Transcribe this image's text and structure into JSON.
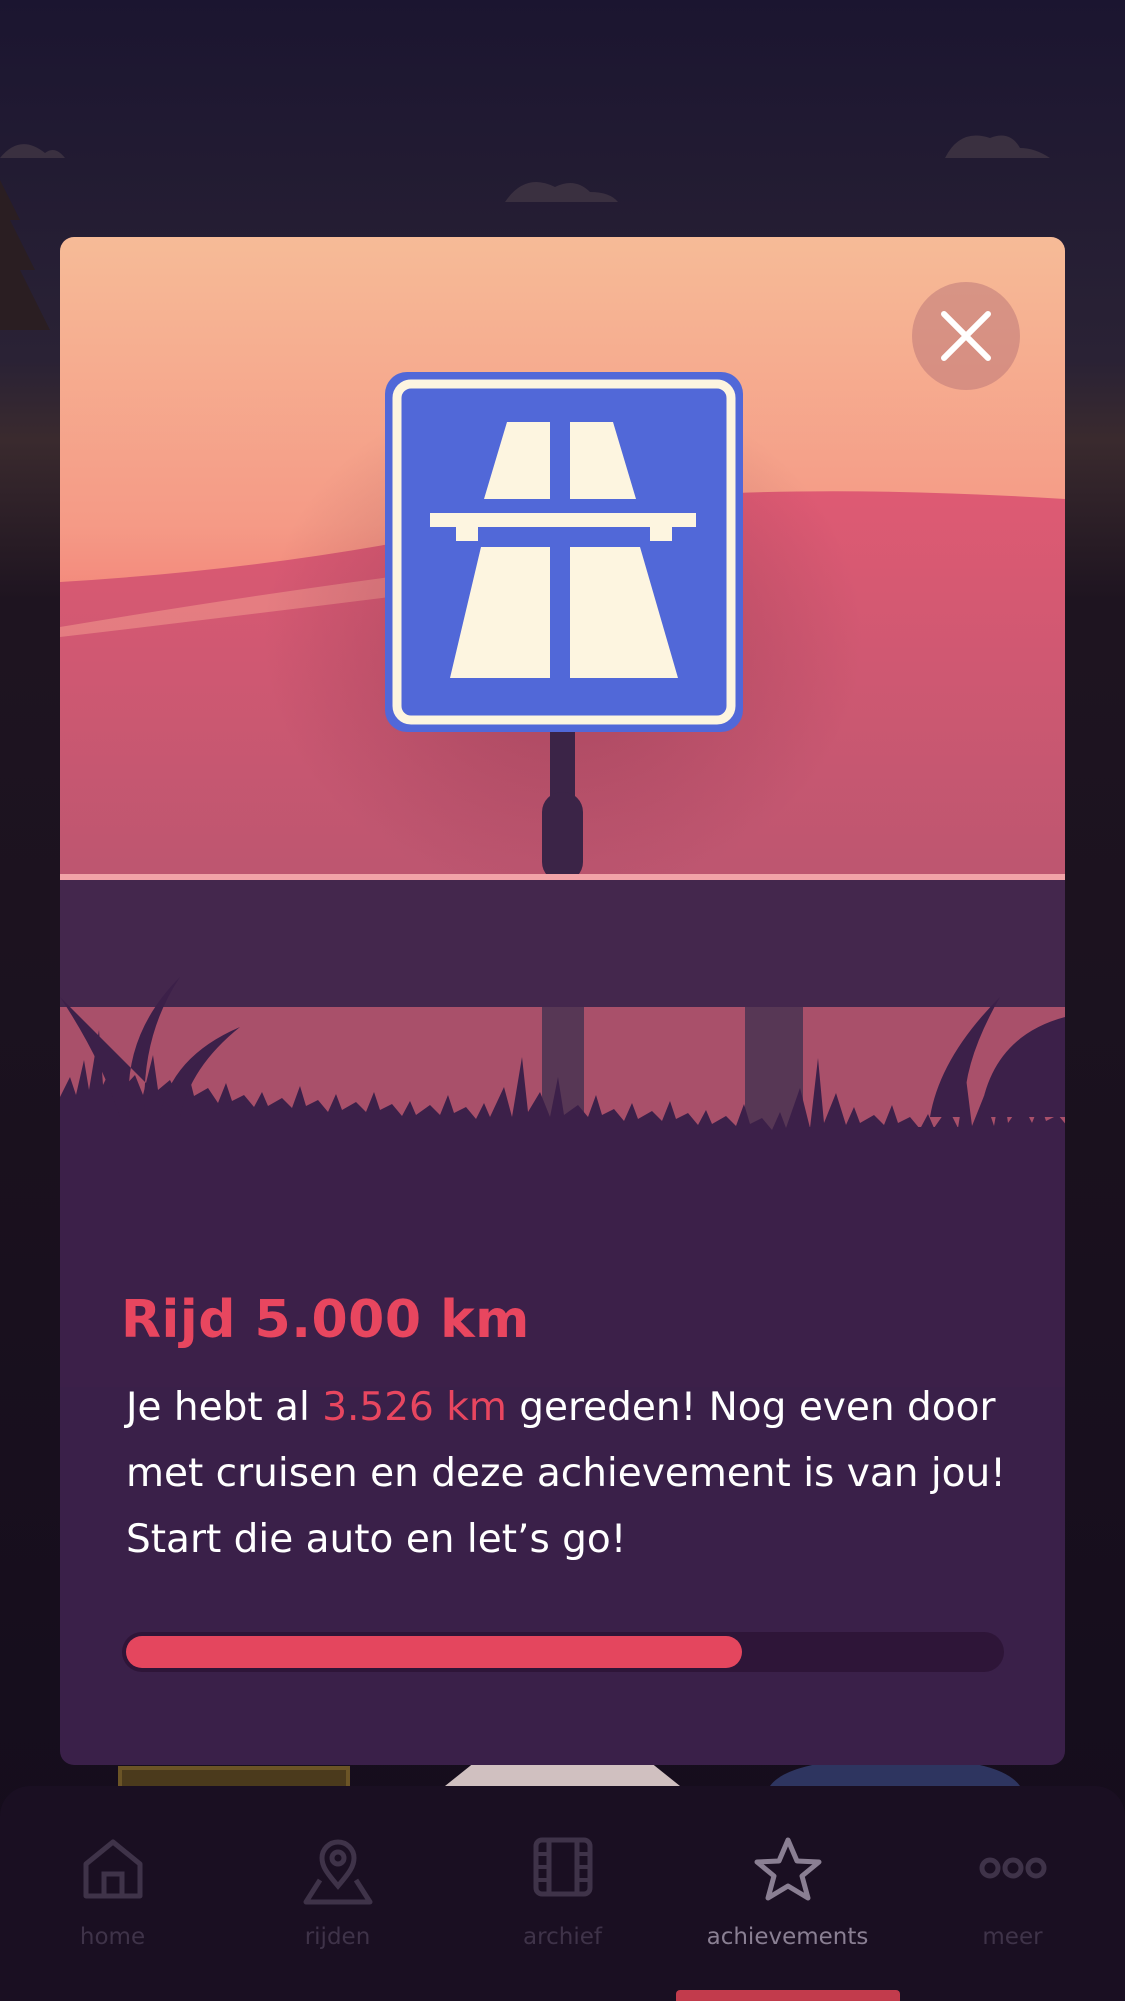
{
  "modal": {
    "title": "Rijd 5.000 km",
    "description_before": "Je hebt al ",
    "description_highlight": "3.526 km",
    "description_after": " gereden! Nog even door met cruisen en deze achievement is van jou! Start die auto en let’s go!",
    "progress_fraction": 0.7052,
    "close_icon": "close-icon",
    "badge_icon": "motorway-sign-icon"
  },
  "colors": {
    "accent": "#e8465f",
    "sign_blue": "#5168d8",
    "sign_cream": "#fdf5e0",
    "card_dark": "#3a2049"
  },
  "tabbar": {
    "items": [
      {
        "label": "home",
        "icon": "home-icon",
        "active": false
      },
      {
        "label": "rijden",
        "icon": "map-pin-icon",
        "active": false
      },
      {
        "label": "archief",
        "icon": "film-icon",
        "active": false
      },
      {
        "label": "achievements",
        "icon": "star-icon",
        "active": true
      },
      {
        "label": "meer",
        "icon": "more-dots-icon",
        "active": false
      }
    ]
  }
}
